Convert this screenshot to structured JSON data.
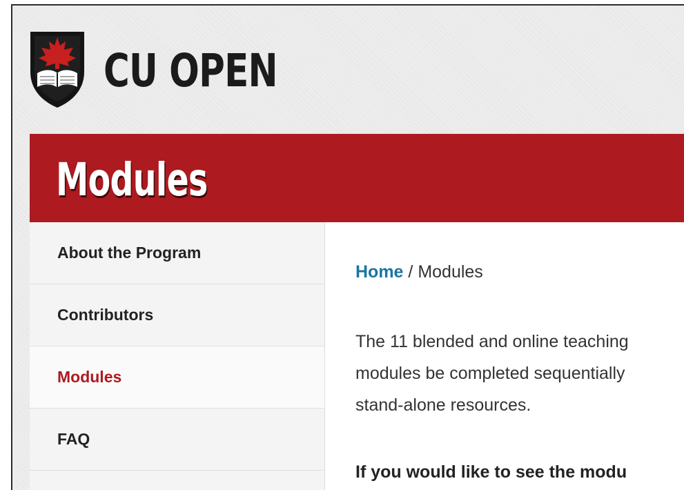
{
  "header": {
    "logo_text": "CU OPEN",
    "logo_icon": "crest-maple-leaf-book-icon"
  },
  "banner": {
    "title": "Modules"
  },
  "sidebar": {
    "items": [
      {
        "label": "About the Program"
      },
      {
        "label": "Contributors"
      },
      {
        "label": "Modules",
        "active": true
      },
      {
        "label": "FAQ"
      }
    ]
  },
  "main": {
    "breadcrumb": {
      "home": "Home",
      "separator": " / ",
      "current": "Modules"
    },
    "intro_lines": [
      "The 11 blended and online teaching",
      "modules be completed sequentially",
      "stand-alone resources."
    ],
    "lead_text": "If you would like to see the modu"
  },
  "colors": {
    "brand_red": "#ad1a1f",
    "link_blue": "#1b74a2",
    "text_dark": "#222222"
  }
}
